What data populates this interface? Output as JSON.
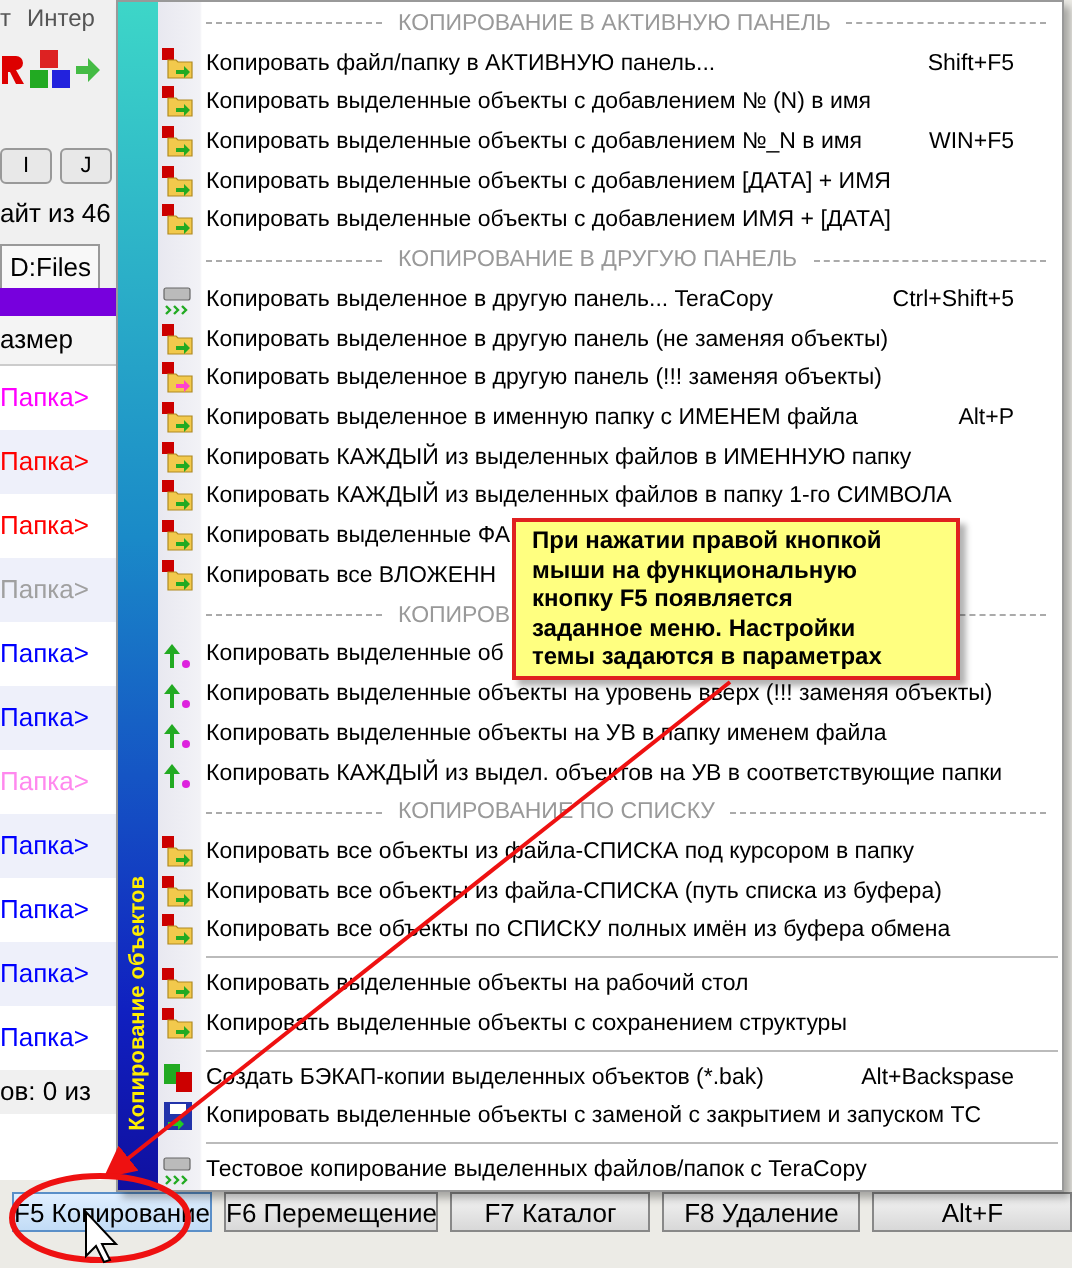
{
  "background_window": {
    "menu_bar": [
      "т",
      "Интер"
    ],
    "drive_buttons": [
      "I",
      "J"
    ],
    "status_text": "айт из 46",
    "tab": "D:Files",
    "column_header": "азмер",
    "rows": [
      {
        "name": "Папка>",
        "color": "#ff00ff"
      },
      {
        "name": "Папка>",
        "color": "#ff0000"
      },
      {
        "name": "Папка>",
        "color": "#ff0000"
      },
      {
        "name": "Папка>",
        "color": "#a0a0a0"
      },
      {
        "name": "Папка>",
        "color": "#0000ff"
      },
      {
        "name": "Папка>",
        "color": "#0000ff"
      },
      {
        "name": "Папка>",
        "color": "#ff88ee"
      },
      {
        "name": "Папка>",
        "color": "#0000ff"
      },
      {
        "name": "Папка>",
        "color": "#0000ff"
      },
      {
        "name": "Папка>",
        "color": "#0000ff"
      },
      {
        "name": "Папка>",
        "color": "#0000ff"
      }
    ],
    "selection_status": "ов: 0 из",
    "function_keys": [
      "F5 Копирование",
      "F6 Перемещение",
      "F7 Каталог",
      "F8 Удаление",
      "Alt+F"
    ]
  },
  "menu": {
    "side_title": "Копирование объектов",
    "items": [
      {
        "kind": "header",
        "label": "КОПИРОВАНИЕ В АКТИВНУЮ ПАНЕЛЬ"
      },
      {
        "kind": "copy",
        "label": "Копировать файл/папку в АКТИВНУЮ панель...",
        "shortcut": "Shift+F5"
      },
      {
        "kind": "copy",
        "label": "Копировать выделенные объекты с добавлением № (N) в имя"
      },
      {
        "kind": "copy",
        "label": "Копировать выделенные объекты с добавлением №_N в имя",
        "shortcut": "WIN+F5"
      },
      {
        "kind": "copy",
        "label": "Копировать выделенные объекты с добавлением [ДАТА] + ИМЯ"
      },
      {
        "kind": "copy",
        "label": "Копировать выделенные объекты с добавлением ИМЯ + [ДАТА]"
      },
      {
        "kind": "header",
        "label": "КОПИРОВАНИЕ В ДРУГУЮ ПАНЕЛЬ"
      },
      {
        "kind": "teracopy",
        "label": "Копировать выделенное в другую панель... TeraCopy",
        "shortcut": "Ctrl+Shift+5"
      },
      {
        "kind": "copy",
        "label": "Копировать выделенное в другую панель (не заменяя объекты)"
      },
      {
        "kind": "replace",
        "label": "Копировать выделенное в другую панель (!!! заменяя объекты)"
      },
      {
        "kind": "copy",
        "label": "Копировать выделенное в именную папку с ИМЕНЕМ файла",
        "shortcut": "Alt+P"
      },
      {
        "kind": "copy",
        "label": "Копировать КАЖДЫЙ из выделенных файлов в ИМЕННУЮ папку"
      },
      {
        "kind": "copy",
        "label": "Копировать КАЖДЫЙ из выделенных файлов в папку 1-го СИМВОЛА"
      },
      {
        "kind": "copy",
        "label": "Копировать выделенные ФА"
      },
      {
        "kind": "copy",
        "label": "Копировать все ВЛОЖЕНН"
      },
      {
        "kind": "header",
        "label": "КОПИРОВ"
      },
      {
        "kind": "up",
        "label": "Копировать выделенные об"
      },
      {
        "kind": "up",
        "label": "Копировать выделенные объекты на уровень вверх (!!! заменяя объекты)"
      },
      {
        "kind": "up",
        "label": "Копировать выделенные объекты на УВ в папку именем файла"
      },
      {
        "kind": "up",
        "label": "Копировать КАЖДЫЙ из выдел. объектов на УВ в соответствующие папки"
      },
      {
        "kind": "header",
        "label": "КОПИРОВАНИЕ ПО СПИСКУ"
      },
      {
        "kind": "copy",
        "label": "Копировать все объекты из файла-СПИСКА под курсором в папку"
      },
      {
        "kind": "copy",
        "label": "Копировать все объекты из файла-СПИСКА (путь списка из буфера)"
      },
      {
        "kind": "copy",
        "label": "Копировать все объекты по СПИСКУ полных имён из буфера обмена"
      },
      {
        "kind": "separator"
      },
      {
        "kind": "copy",
        "label": "Копировать выделенные объекты на рабочий стол"
      },
      {
        "kind": "copy",
        "label": "Копировать выделенные объекты с сохранением структуры"
      },
      {
        "kind": "separator"
      },
      {
        "kind": "backup",
        "label": "Создать БЭКАП-копии выделенных объектов (*.bak)",
        "shortcut": "Alt+Backspase"
      },
      {
        "kind": "restart",
        "label": "Копировать выделенные объекты с заменой с закрытием и запуском TC"
      },
      {
        "kind": "separator"
      },
      {
        "kind": "teracopy",
        "label": "Тестовое копирование выделенных файлов/папок с TeraCopy"
      }
    ]
  },
  "callout": {
    "lines": [
      "При нажатии правой кнопкой",
      "мыши на функциональную",
      "кнопку F5 появляется",
      "заданное меню. Настройки",
      "темы задаются в параметрах"
    ]
  }
}
